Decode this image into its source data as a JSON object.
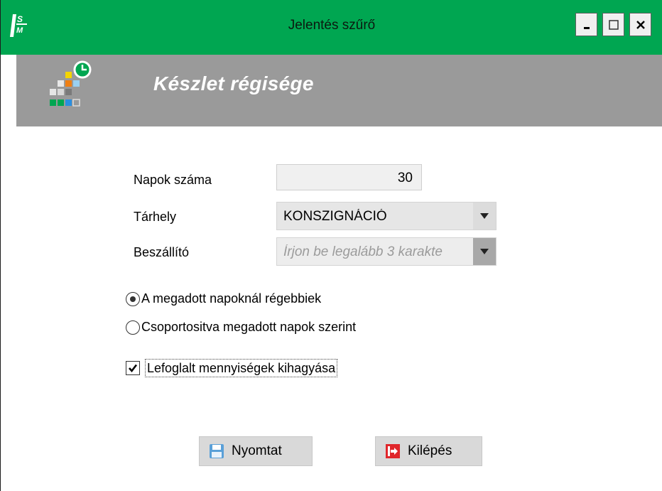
{
  "window": {
    "title": "Jelentés szűrő",
    "accent_color": "#00a651"
  },
  "icons": {
    "app_logo": "ism-logo-icon",
    "report": "report-clock-icon",
    "minimize": "minimize-icon",
    "maximize": "maximize-icon",
    "close": "close-icon",
    "print": "floppy-disk-icon",
    "exit": "exit-door-icon",
    "dropdown": "chevron-down-icon"
  },
  "banner": {
    "title": "Készlet régisége"
  },
  "form": {
    "days_label": "Napok száma",
    "days_value": "30",
    "storage_label": "Tárhely",
    "storage_value": "KONSZIGNÁCIÓ",
    "supplier_label": "Beszállító",
    "supplier_placeholder": "Írjon be legalább 3 karakte"
  },
  "options": {
    "radio_older": "A megadott napoknál régebbiek",
    "radio_grouped": "Csoportositva megadott napok szerint",
    "radio_selected": "older",
    "checkbox_label": "Lefoglalt mennyiségek kihagyása",
    "checkbox_checked": true
  },
  "buttons": {
    "print_label": "Nyomtat",
    "exit_label": "Kilépés"
  }
}
